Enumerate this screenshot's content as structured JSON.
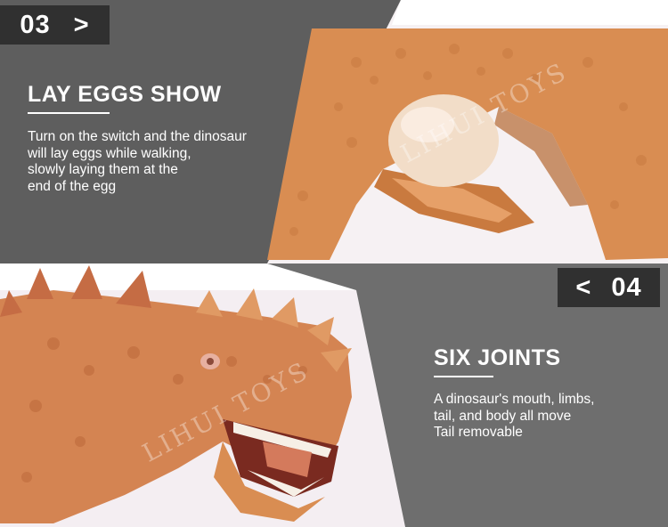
{
  "sections": [
    {
      "number": "03",
      "arrow": ">",
      "title": "LAY EGGS SHOW",
      "lines": [
        "Turn on the switch and the dinosaur",
        "will lay eggs while walking,",
        "slowly laying them at the",
        "end of the egg"
      ],
      "watermark": "LIHUI TOYS"
    },
    {
      "number": "04",
      "arrow": "<",
      "title": "SIX JOINTS",
      "lines": [
        "A dinosaur's mouth, limbs,",
        "tail, and body all move",
        "Tail removable"
      ],
      "watermark": "LIHUI TOYS"
    }
  ],
  "colors": {
    "panel_gray": "#5e5e5e",
    "tag_dark": "#303030",
    "toy_orange": "#d98d52"
  }
}
